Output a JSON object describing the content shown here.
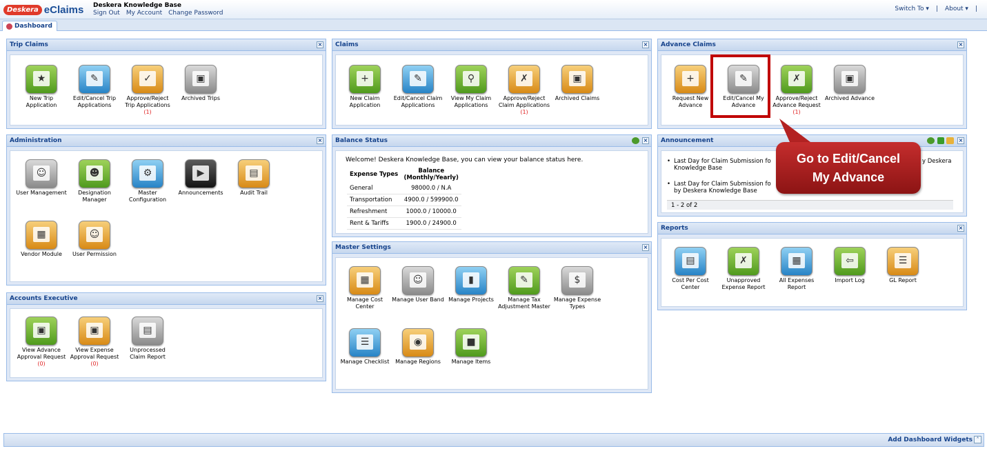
{
  "app": {
    "brand": "Deskera",
    "product": "eClaims",
    "company": "Deskera Knowledge Base",
    "links": [
      "Sign Out",
      "My Account",
      "Change Password"
    ],
    "switch_to": "Switch To ▾",
    "about": "About ▾",
    "divider": "|"
  },
  "tabs": [
    {
      "label": "Dashboard"
    }
  ],
  "trip_claims": {
    "title": "Trip Claims",
    "tiles": [
      {
        "label": "New Trip Application",
        "count": ""
      },
      {
        "label": "Edit/Cancel Trip Applications",
        "count": ""
      },
      {
        "label": "Approve/Reject Trip Applications",
        "count": "(1)"
      },
      {
        "label": "Archived Trips",
        "count": ""
      }
    ]
  },
  "administration": {
    "title": "Administration",
    "tiles": [
      {
        "label": "User Management"
      },
      {
        "label": "Designation Manager"
      },
      {
        "label": "Master Configuration"
      },
      {
        "label": "Announcements"
      },
      {
        "label": "Audit Trail"
      },
      {
        "label": "Vendor Module"
      },
      {
        "label": "User Permission"
      }
    ]
  },
  "accounts_executive": {
    "title": "Accounts Executive",
    "tiles": [
      {
        "label": "View Advance Approval Request",
        "count": "(0)"
      },
      {
        "label": "View Expense Approval Request",
        "count": "(0)"
      },
      {
        "label": "Unprocessed Claim Report",
        "count": ""
      }
    ]
  },
  "claims": {
    "title": "Claims",
    "tiles": [
      {
        "label": "New Claim Application",
        "count": ""
      },
      {
        "label": "Edit/Cancel Claim Applications",
        "count": ""
      },
      {
        "label": "View My Claim Applications",
        "count": ""
      },
      {
        "label": "Approve/Reject Claim Applications",
        "count": "(1)"
      },
      {
        "label": "Archived Claims",
        "count": ""
      }
    ]
  },
  "balance_status": {
    "title": "Balance Status",
    "welcome": "Welcome! Deskera Knowledge Base, you can view your balance status here.",
    "col_type": "Expense Types",
    "col_balance": "Balance (Monthly/Yearly)",
    "rows": [
      {
        "type": "General",
        "value": "98000.0 / N.A"
      },
      {
        "type": "Transportation",
        "value": "4900.0 / 599900.0"
      },
      {
        "type": "Refreshment",
        "value": "1000.0 / 10000.0"
      },
      {
        "type": "Rent & Tariffs",
        "value": "1900.0 / 24900.0"
      }
    ]
  },
  "master_settings": {
    "title": "Master Settings",
    "tiles": [
      {
        "label": "Manage Cost Center"
      },
      {
        "label": "Manage User Band"
      },
      {
        "label": "Manage Projects"
      },
      {
        "label": "Manage Tax Adjustment Master"
      },
      {
        "label": "Manage Expense Types"
      },
      {
        "label": "Manage Checklist"
      },
      {
        "label": "Manage Regions"
      },
      {
        "label": "Manage Items"
      }
    ]
  },
  "advance_claims": {
    "title": "Advance Claims",
    "tiles": [
      {
        "label": "Request New Advance",
        "count": ""
      },
      {
        "label": "Edit/Cancel My Advance",
        "count": ""
      },
      {
        "label": "Approve/Reject Advance Request",
        "count": "(1)"
      },
      {
        "label": "Archived Advance",
        "count": ""
      }
    ]
  },
  "announcement": {
    "title": "Announcement",
    "items": [
      {
        "text": "Last Day for Claim Submission fo",
        "tail": "y Deskera",
        "line2": "Knowledge Base"
      },
      {
        "text": "Last Day for Claim Submission fo",
        "tail": "",
        "line2": "by Deskera Knowledge Base"
      }
    ],
    "pager": "1 - 2 of 2"
  },
  "reports": {
    "title": "Reports",
    "tiles": [
      {
        "label": "Cost Per Cost Center"
      },
      {
        "label": "Unapproved Expense Report"
      },
      {
        "label": "All Expenses Report"
      },
      {
        "label": "Import Log"
      },
      {
        "label": "GL Report"
      }
    ]
  },
  "callout": {
    "line1": "Go to Edit/Cancel",
    "line2": "My Advance"
  },
  "footer": {
    "add_widgets": "Add Dashboard Widgets"
  },
  "close_glyph": "×",
  "icons": [
    "close-icon",
    "refresh-icon",
    "add-icon",
    "edit-icon",
    "chevron-up-icon",
    "dashboard-icon"
  ]
}
